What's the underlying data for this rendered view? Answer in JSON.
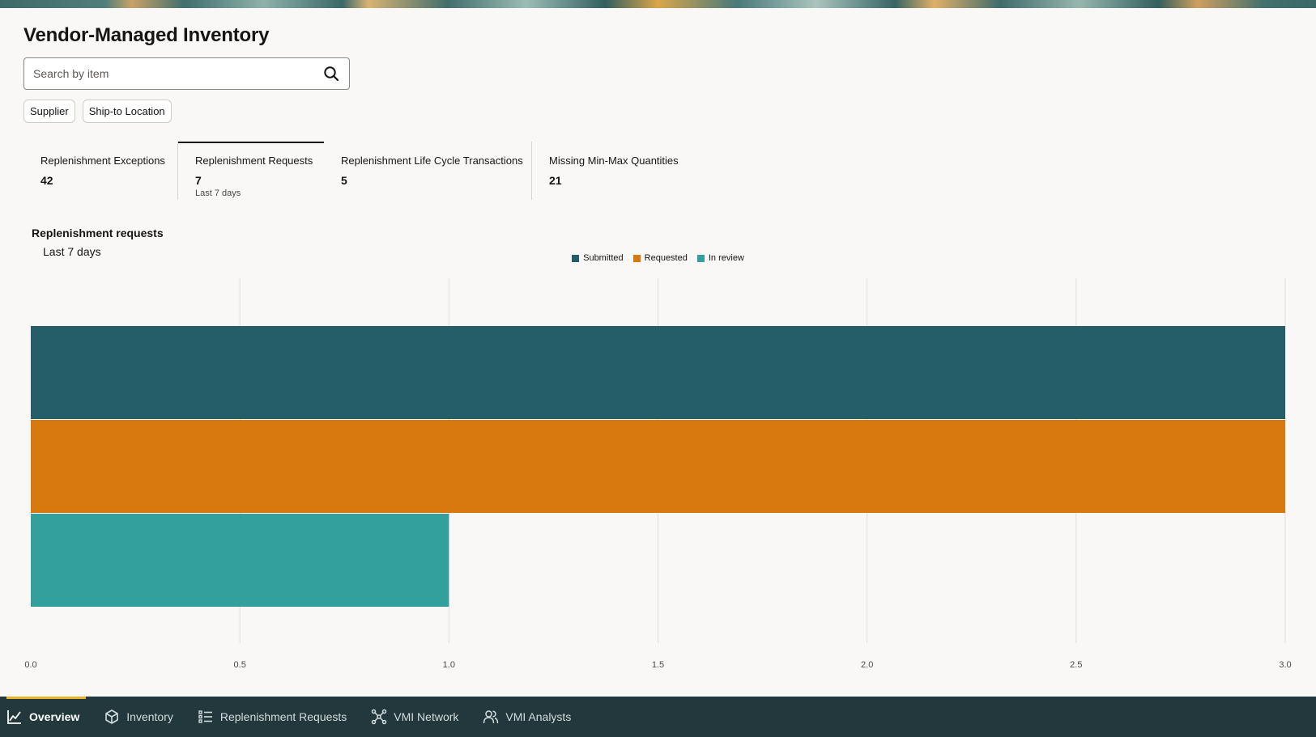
{
  "page": {
    "title": "Vendor-Managed Inventory"
  },
  "search": {
    "placeholder": "Search by item",
    "value": ""
  },
  "filters": [
    {
      "label": "Supplier"
    },
    {
      "label": "Ship-to Location"
    }
  ],
  "metrics": [
    {
      "label": "Replenishment Exceptions",
      "value": "42",
      "sub": "",
      "active": false
    },
    {
      "label": "Replenishment Requests",
      "value": "7",
      "sub": "Last 7 days",
      "active": true
    },
    {
      "label": "Replenishment Life Cycle Transactions",
      "value": "5",
      "sub": "",
      "active": false
    },
    {
      "label": "Missing Min-Max Quantities",
      "value": "21",
      "sub": "",
      "active": false
    }
  ],
  "section": {
    "title": "Replenishment requests",
    "subtitle": "Last 7 days"
  },
  "chart_data": {
    "type": "bar",
    "orientation": "horizontal",
    "series": [
      {
        "name": "Submitted",
        "value": 3,
        "color": "#255e68"
      },
      {
        "name": "Requested",
        "value": 3,
        "color": "#d8790f"
      },
      {
        "name": "In review",
        "value": 1,
        "color": "#33a09e"
      }
    ],
    "xlim": [
      0,
      3
    ],
    "x_ticks": [
      "0.0",
      "0.5",
      "1.0",
      "1.5",
      "2.0",
      "2.5",
      "3.0"
    ],
    "legend_position": "top-center",
    "grid": true
  },
  "nav": [
    {
      "label": "Overview",
      "icon": "chart-line-icon",
      "active": true
    },
    {
      "label": "Inventory",
      "icon": "cube-icon",
      "active": false
    },
    {
      "label": "Replenishment Requests",
      "icon": "list-icon",
      "active": false
    },
    {
      "label": "VMI Network",
      "icon": "network-icon",
      "active": false
    },
    {
      "label": "VMI Analysts",
      "icon": "users-icon",
      "active": false
    }
  ]
}
